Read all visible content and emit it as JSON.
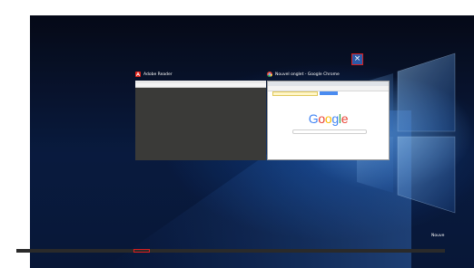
{
  "windows": [
    {
      "title": "Adobe Reader",
      "icon": "adobe-reader-icon",
      "accent": "#e2231a"
    },
    {
      "title": "Nouvel onglet - Google Chrome",
      "icon": "chrome-icon",
      "close_glyph": "×",
      "content": {
        "logo_letters": [
          "G",
          "o",
          "o",
          "g",
          "l",
          "e"
        ],
        "logo_colors": [
          "#4285F4",
          "#EA4335",
          "#FBBC05",
          "#4285F4",
          "#34A853",
          "#EA4335"
        ]
      }
    }
  ],
  "desktop": {
    "new_desktop_label": "Nouve"
  },
  "colors": {
    "close_highlight": "#d91e1e",
    "close_bg": "#2b5aa8"
  }
}
